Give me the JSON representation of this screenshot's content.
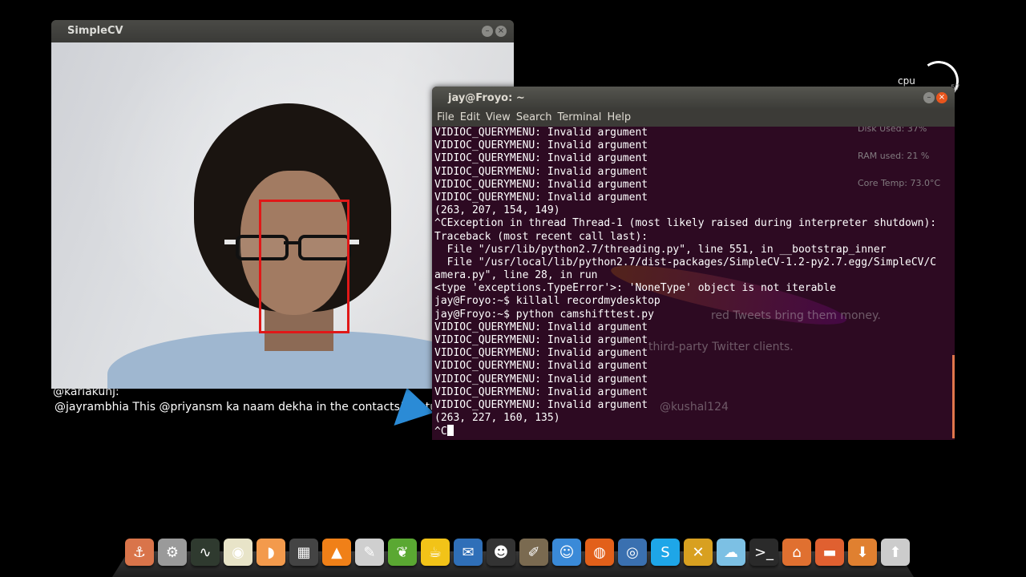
{
  "desktop": {
    "cpu_widget": {
      "label": "cpu",
      "value": "57"
    },
    "feed": {
      "username": "@kariakunj:",
      "tweet": "@jayrambhia This @priyansm ka naam dekha in the contacts! Bc tur",
      "promo_line_1": "red Tweets bring them money.",
      "promo_line_2": "third-party Twitter clients.",
      "mention": "@kushal124"
    },
    "sysmon": {
      "disk": "Disk Used: 37%",
      "ram": "RAM used: 21 %",
      "temp": "Core Temp: 73.0°C"
    }
  },
  "simplecv_window": {
    "title": "SimpleCV",
    "minimize_symbol": "–",
    "close_symbol": "×"
  },
  "terminal_window": {
    "title": "jay@Froyo: ~",
    "minimize_symbol": "–",
    "close_symbol": "×",
    "menu": [
      "File",
      "Edit",
      "View",
      "Search",
      "Terminal",
      "Help"
    ],
    "lines": [
      "VIDIOC_QUERYMENU: Invalid argument",
      "VIDIOC_QUERYMENU: Invalid argument",
      "VIDIOC_QUERYMENU: Invalid argument",
      "VIDIOC_QUERYMENU: Invalid argument",
      "VIDIOC_QUERYMENU: Invalid argument",
      "VIDIOC_QUERYMENU: Invalid argument",
      "(263, 207, 154, 149)",
      "^CException in thread Thread-1 (most likely raised during interpreter shutdown):",
      "Traceback (most recent call last):",
      "  File \"/usr/lib/python2.7/threading.py\", line 551, in __bootstrap_inner",
      "  File \"/usr/local/lib/python2.7/dist-packages/SimpleCV-1.2-py2.7.egg/SimpleCV/C",
      "amera.py\", line 28, in run",
      "<type 'exceptions.TypeError'>: 'NoneType' object is not iterable",
      "jay@Froyo:~$ killall recordmydesktop",
      "jay@Froyo:~$ python camshifttest.py",
      "VIDIOC_QUERYMENU: Invalid argument",
      "VIDIOC_QUERYMENU: Invalid argument",
      "VIDIOC_QUERYMENU: Invalid argument",
      "VIDIOC_QUERYMENU: Invalid argument",
      "VIDIOC_QUERYMENU: Invalid argument",
      "VIDIOC_QUERYMENU: Invalid argument",
      "VIDIOC_QUERYMENU: Invalid argument",
      "(263, 227, 160, 135)",
      "^C"
    ]
  },
  "dock": {
    "items": [
      {
        "name": "anchor-icon",
        "glyph": "⚓",
        "color": "#d9744a"
      },
      {
        "name": "system-settings-icon",
        "glyph": "⚙",
        "color": "#9a9a9a"
      },
      {
        "name": "system-monitor-icon",
        "glyph": "∿",
        "color": "#2f3a2f"
      },
      {
        "name": "speaker-icon",
        "glyph": "◉",
        "color": "#e8e4c8"
      },
      {
        "name": "orange-slice-icon",
        "glyph": "◗",
        "color": "#f39a4c"
      },
      {
        "name": "clapperboard-icon",
        "glyph": "▦",
        "color": "#444444"
      },
      {
        "name": "vlc-icon",
        "glyph": "▲",
        "color": "#f08018"
      },
      {
        "name": "text-editor-icon",
        "glyph": "✎",
        "color": "#cfcfcf"
      },
      {
        "name": "leaf-icon",
        "glyph": "❦",
        "color": "#5aa832"
      },
      {
        "name": "teapot-icon",
        "glyph": "☕",
        "color": "#f2c318"
      },
      {
        "name": "thunderbird-icon",
        "glyph": "✉",
        "color": "#2f6fb8"
      },
      {
        "name": "penguin-icon",
        "glyph": "☻",
        "color": "#333333"
      },
      {
        "name": "gimp-icon",
        "glyph": "✐",
        "color": "#7a6a50"
      },
      {
        "name": "robot-icon",
        "glyph": "☺",
        "color": "#3a8ad8"
      },
      {
        "name": "firefox-icon",
        "glyph": "◍",
        "color": "#e2601a"
      },
      {
        "name": "chromium-icon",
        "glyph": "◎",
        "color": "#3a70b0"
      },
      {
        "name": "skype-icon",
        "glyph": "S",
        "color": "#1ea6e8"
      },
      {
        "name": "chat-icon",
        "glyph": "✕",
        "color": "#d8a020"
      },
      {
        "name": "weather-icon",
        "glyph": "☁",
        "color": "#7cc0e4"
      },
      {
        "name": "terminal-icon",
        "glyph": ">_",
        "color": "#2a2a2a"
      },
      {
        "name": "home-folder-icon",
        "glyph": "⌂",
        "color": "#e07030"
      },
      {
        "name": "folder-icon",
        "glyph": "▬",
        "color": "#e06030"
      },
      {
        "name": "downloads-folder-icon",
        "glyph": "⬇",
        "color": "#e08030"
      },
      {
        "name": "installer-icon",
        "glyph": "⬆",
        "color": "#cccccc"
      }
    ]
  }
}
